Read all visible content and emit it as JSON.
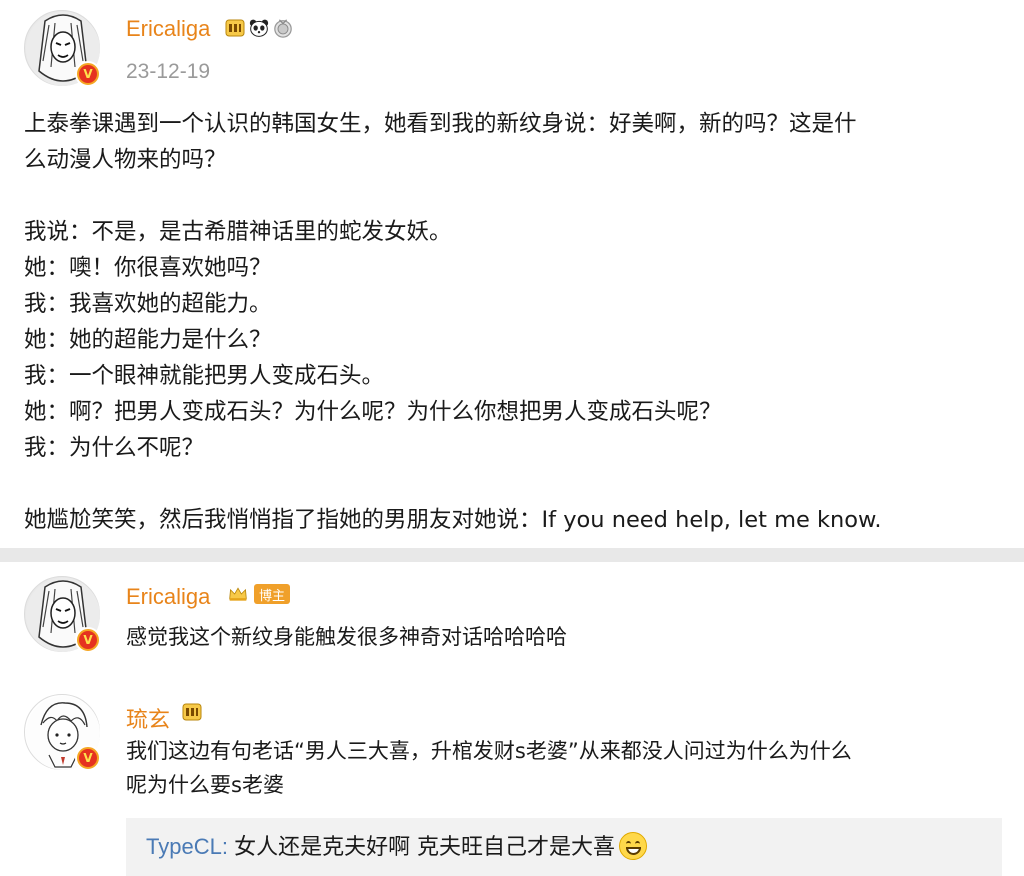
{
  "post": {
    "author": "Ericaliga",
    "date": "23-12-19",
    "verified_mark": "V",
    "badge_icons": [
      "vip-level-icon",
      "panda-icon",
      "medal-icon"
    ],
    "body": [
      "上泰拳课遇到一个认识的韩国女生，她看到我的新纹身说：好美啊，新的吗？这是什",
      "么动漫人物来的吗？",
      "",
      "我说：不是，是古希腊神话里的蛇发女妖。",
      "她：噢！你很喜欢她吗？",
      "我：我喜欢她的超能力。",
      "她：她的超能力是什么？",
      "我：一个眼神就能把男人变成石头。",
      "她：啊？把男人变成石头？为什么呢？为什么你想把男人变成石头呢？",
      "我：为什么不呢？",
      "",
      "她尴尬笑笑，然后我悄悄指了指她的男朋友对她说：If you need help, let me know."
    ]
  },
  "comments": [
    {
      "author": "Ericaliga",
      "author_tag": "博主",
      "verified_mark": "V",
      "lines": [
        "感觉我这个新纹身能触发很多神奇对话哈哈哈哈"
      ]
    },
    {
      "author": "琉玄",
      "verified_mark": "V",
      "lines": [
        "我们这边有句老话“男人三大喜，升棺发财s老婆”从来都没人问过为什么为什么",
        "呢为什么要s老婆"
      ],
      "reply": {
        "name": "TypeCL",
        "separator": ": ",
        "text": "女人还是克夫好啊 克夫旺自己才是大喜",
        "emoji": "grinning-face-icon"
      }
    }
  ],
  "colors": {
    "username": "#e8841a",
    "date": "#9a9a9a",
    "reply_name": "#4a7ab5",
    "reply_bg": "#f2f2f2",
    "divider": "#e8e8e8",
    "verified_badge": "#e5321f"
  }
}
